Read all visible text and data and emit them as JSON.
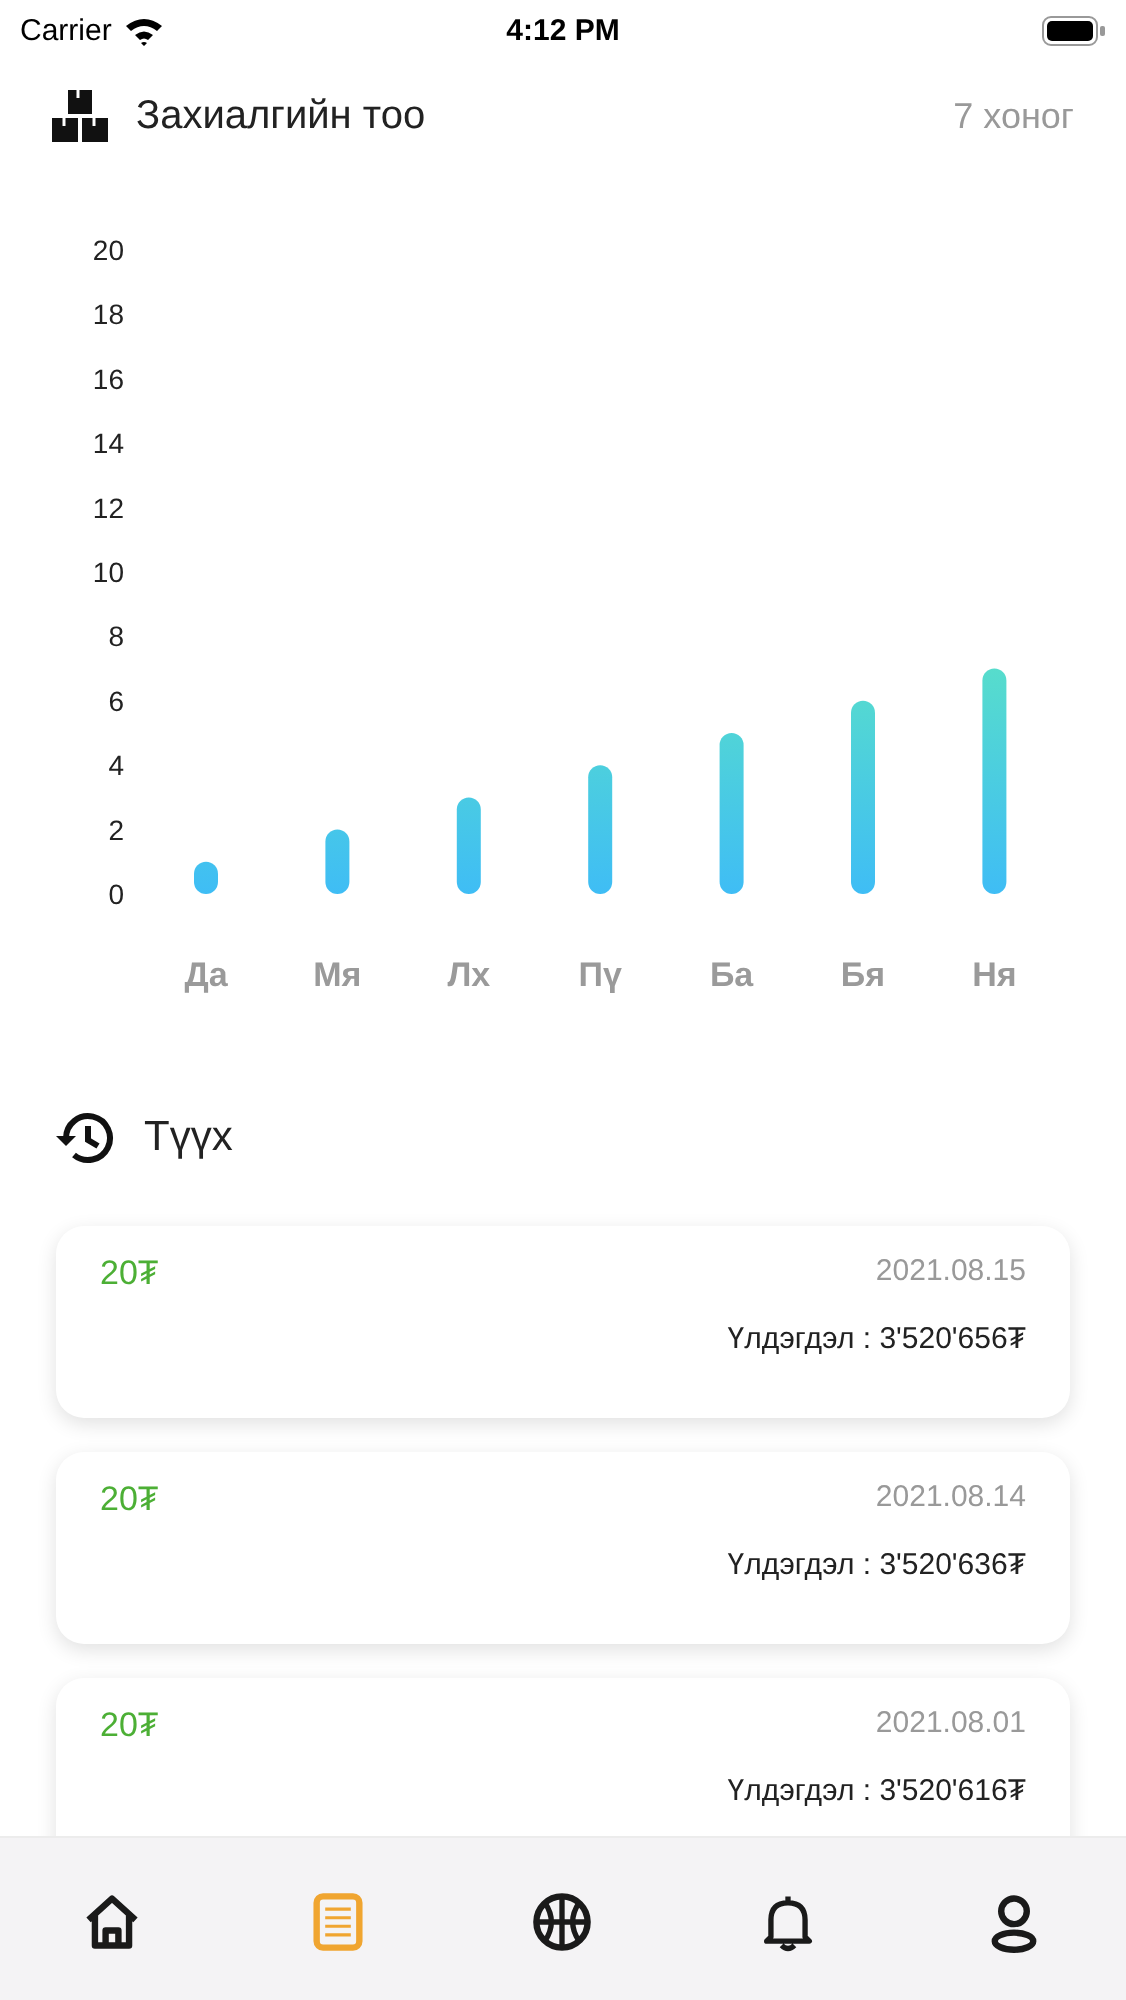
{
  "status_bar": {
    "carrier": "Carrier",
    "time": "4:12 PM"
  },
  "orders": {
    "title": "Захиалгийн тоо",
    "period": "7 хоног",
    "chart_data": {
      "type": "bar",
      "categories": [
        "Да",
        "Мя",
        "Лх",
        "Пү",
        "Ба",
        "Бя",
        "Ня"
      ],
      "values": [
        1,
        2,
        3,
        4,
        5,
        6,
        7
      ],
      "ylim": [
        0,
        20
      ],
      "yticks": [
        0,
        2,
        4,
        6,
        8,
        10,
        12,
        14,
        16,
        18,
        20
      ]
    }
  },
  "history": {
    "title": "Түүх",
    "entries": [
      {
        "amount": "20₮",
        "date": "2021.08.15",
        "balance": "Үлдэгдэл : 3'520'656₮"
      },
      {
        "amount": "20₮",
        "date": "2021.08.14",
        "balance": "Үлдэгдэл : 3'520'636₮"
      },
      {
        "amount": "20₮",
        "date": "2021.08.01",
        "balance": "Үлдэгдэл : 3'520'616₮"
      }
    ]
  },
  "tab_bar": [
    {
      "selected": false
    },
    {
      "selected": true
    },
    {
      "selected": false
    },
    {
      "selected": false
    },
    {
      "selected": false
    }
  ]
}
